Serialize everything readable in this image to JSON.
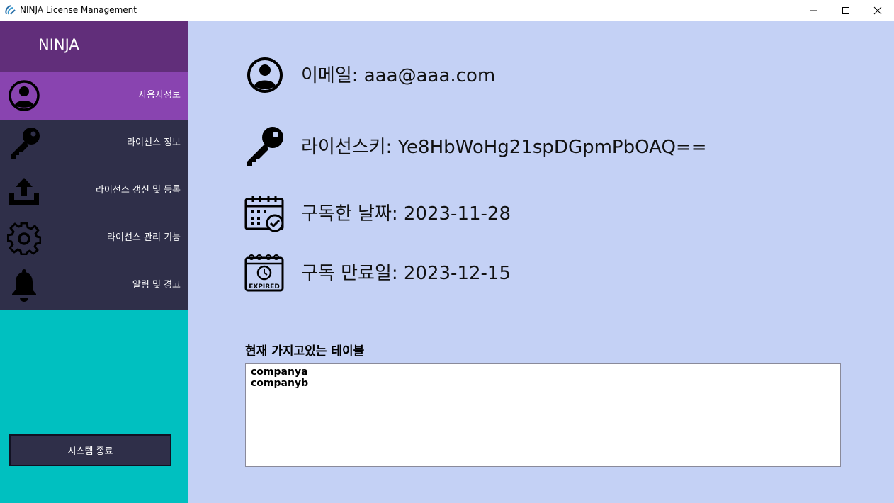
{
  "window": {
    "title": "NINJA License Management",
    "controls": [
      "minimize",
      "maximize",
      "close"
    ]
  },
  "sidebar": {
    "brand": "NINJA",
    "items": [
      {
        "label": "사용자정보",
        "icon": "user-circle-icon",
        "active": true
      },
      {
        "label": "라이선스 정보",
        "icon": "key-icon",
        "active": false
      },
      {
        "label": "라이선스 갱신 및 등록",
        "icon": "upload-icon",
        "active": false
      },
      {
        "label": "라이선스 관리 기능",
        "icon": "gear-icon",
        "active": false
      },
      {
        "label": "알림 및 경고",
        "icon": "bell-icon",
        "active": false
      }
    ],
    "exit_label": "시스템 종료"
  },
  "main": {
    "email": "이메일: aaa@aaa.com",
    "license_key": "라이선스키: Ye8HbWoHg21spDGpmPbOAQ==",
    "subscribed_date": "구독한 날짜: 2023-11-28",
    "expiry_date": "구독 만료일: 2023-12-15",
    "expired_badge": "EXPIRED",
    "tables_title": "현재 가지고있는 테이블",
    "tables": [
      "companya",
      "companyb"
    ]
  },
  "colors": {
    "brand_bg": "#612e7a",
    "nav_bg": "#2f2f49",
    "nav_active": "#8944b0",
    "sidebar_bg": "#00c0c0",
    "main_bg": "#c4d1f5"
  }
}
